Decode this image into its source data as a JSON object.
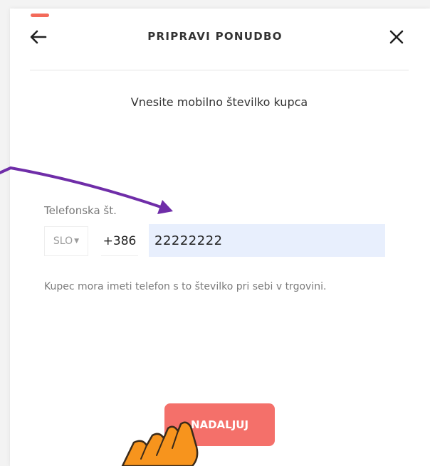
{
  "header": {
    "title": "PRIPRAVI PONUDBO",
    "back_icon": "arrow-left-icon",
    "close_icon": "close-icon"
  },
  "main": {
    "subtitle": "Vnesite mobilno številko kupca",
    "phone": {
      "label": "Telefonska št.",
      "country": "SLO",
      "prefix": "+386",
      "value": "22222222"
    },
    "hint": "Kupec mora imeti telefon s to številko pri sebi v trgovini.",
    "continue_label": "NADALJUJ"
  },
  "annotations": {
    "arrow_color": "#6f2da8",
    "hand_icon": "pointing-hand-icon",
    "hand_color": "#f7941d"
  },
  "colors": {
    "accent": "#f4706a",
    "input_bg": "#e8effd"
  }
}
